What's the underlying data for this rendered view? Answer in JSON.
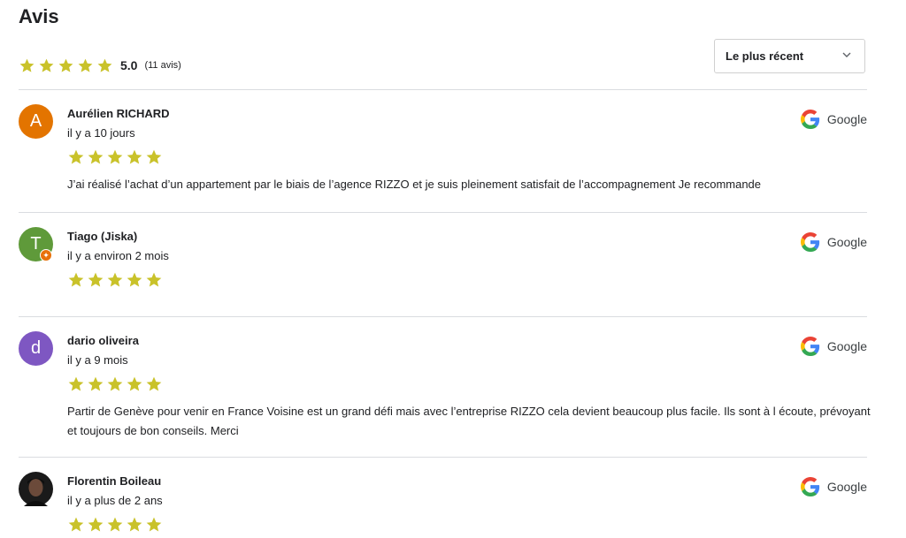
{
  "header": {
    "title": "Avis"
  },
  "summary": {
    "rating": 5.0,
    "score": "5.0",
    "count_label": "(11 avis)",
    "star_color": "#c9c22a"
  },
  "sort": {
    "selected": "Le plus récent"
  },
  "reviews": [
    {
      "name": "Aurélien RICHARD",
      "initial": "A",
      "avatar_color": "#e37400",
      "time": "il y a 10 jours",
      "rating": 5,
      "text": "J’ai réalisé l’achat d’un appartement par le biais de l’agence RIZZO et je suis pleinement satisfait de l’accompagnement Je recommande",
      "source": "Google"
    },
    {
      "name": "Tiago (Jiska)",
      "initial": "T",
      "avatar_color": "#5f9a3a",
      "local_guide_icon": "local-guide-badge",
      "time": "il y a environ 2 mois",
      "rating": 5,
      "text": "",
      "source": "Google"
    },
    {
      "name": "dario oliveira",
      "initial": "d",
      "avatar_color": "#7e57c2",
      "time": "il y a 9 mois",
      "rating": 5,
      "text": "Partir de Genève pour venir en France Voisine est un grand défi mais avec l’entreprise RIZZO cela devient beaucoup plus facile. Ils sont à l écoute, prévoyant et toujours de bon conseils. Merci",
      "source": "Google"
    },
    {
      "name": "Florentin Boileau",
      "initial": "",
      "avatar_color": "#2b2b2b",
      "avatar_type": "photo",
      "time": "il y a plus de 2 ans",
      "rating": 5,
      "text": "",
      "source": "Google"
    }
  ],
  "icons": {
    "star": "star-icon",
    "google": "google-g-icon",
    "chevron": "chevron-down-icon"
  }
}
